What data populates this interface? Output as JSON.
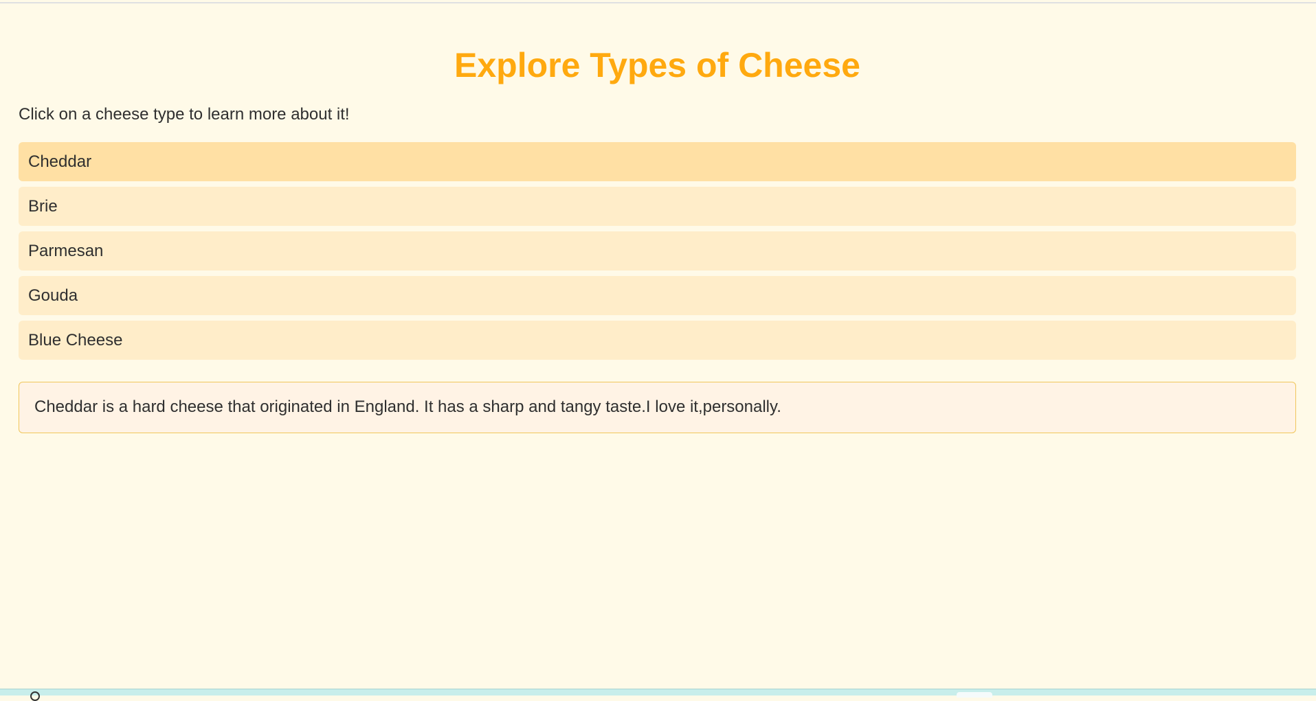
{
  "page": {
    "title": "Explore Types of Cheese",
    "intro": "Click on a cheese type to learn more about it!"
  },
  "cheeses": [
    {
      "label": "Cheddar",
      "selected": true
    },
    {
      "label": "Brie",
      "selected": false
    },
    {
      "label": "Parmesan",
      "selected": false
    },
    {
      "label": "Gouda",
      "selected": false
    },
    {
      "label": "Blue Cheese",
      "selected": false
    }
  ],
  "description": {
    "text": "Cheddar is a hard cheese that originated in England. It has a sharp and tangy taste.I love it,personally."
  },
  "colors": {
    "background": "#FFFAE8",
    "title": "#FFA90F",
    "item": "#FFEDC9",
    "item_selected": "#FFE0A4",
    "description_bg": "#FFF3E5",
    "description_border": "#F0C65A"
  }
}
